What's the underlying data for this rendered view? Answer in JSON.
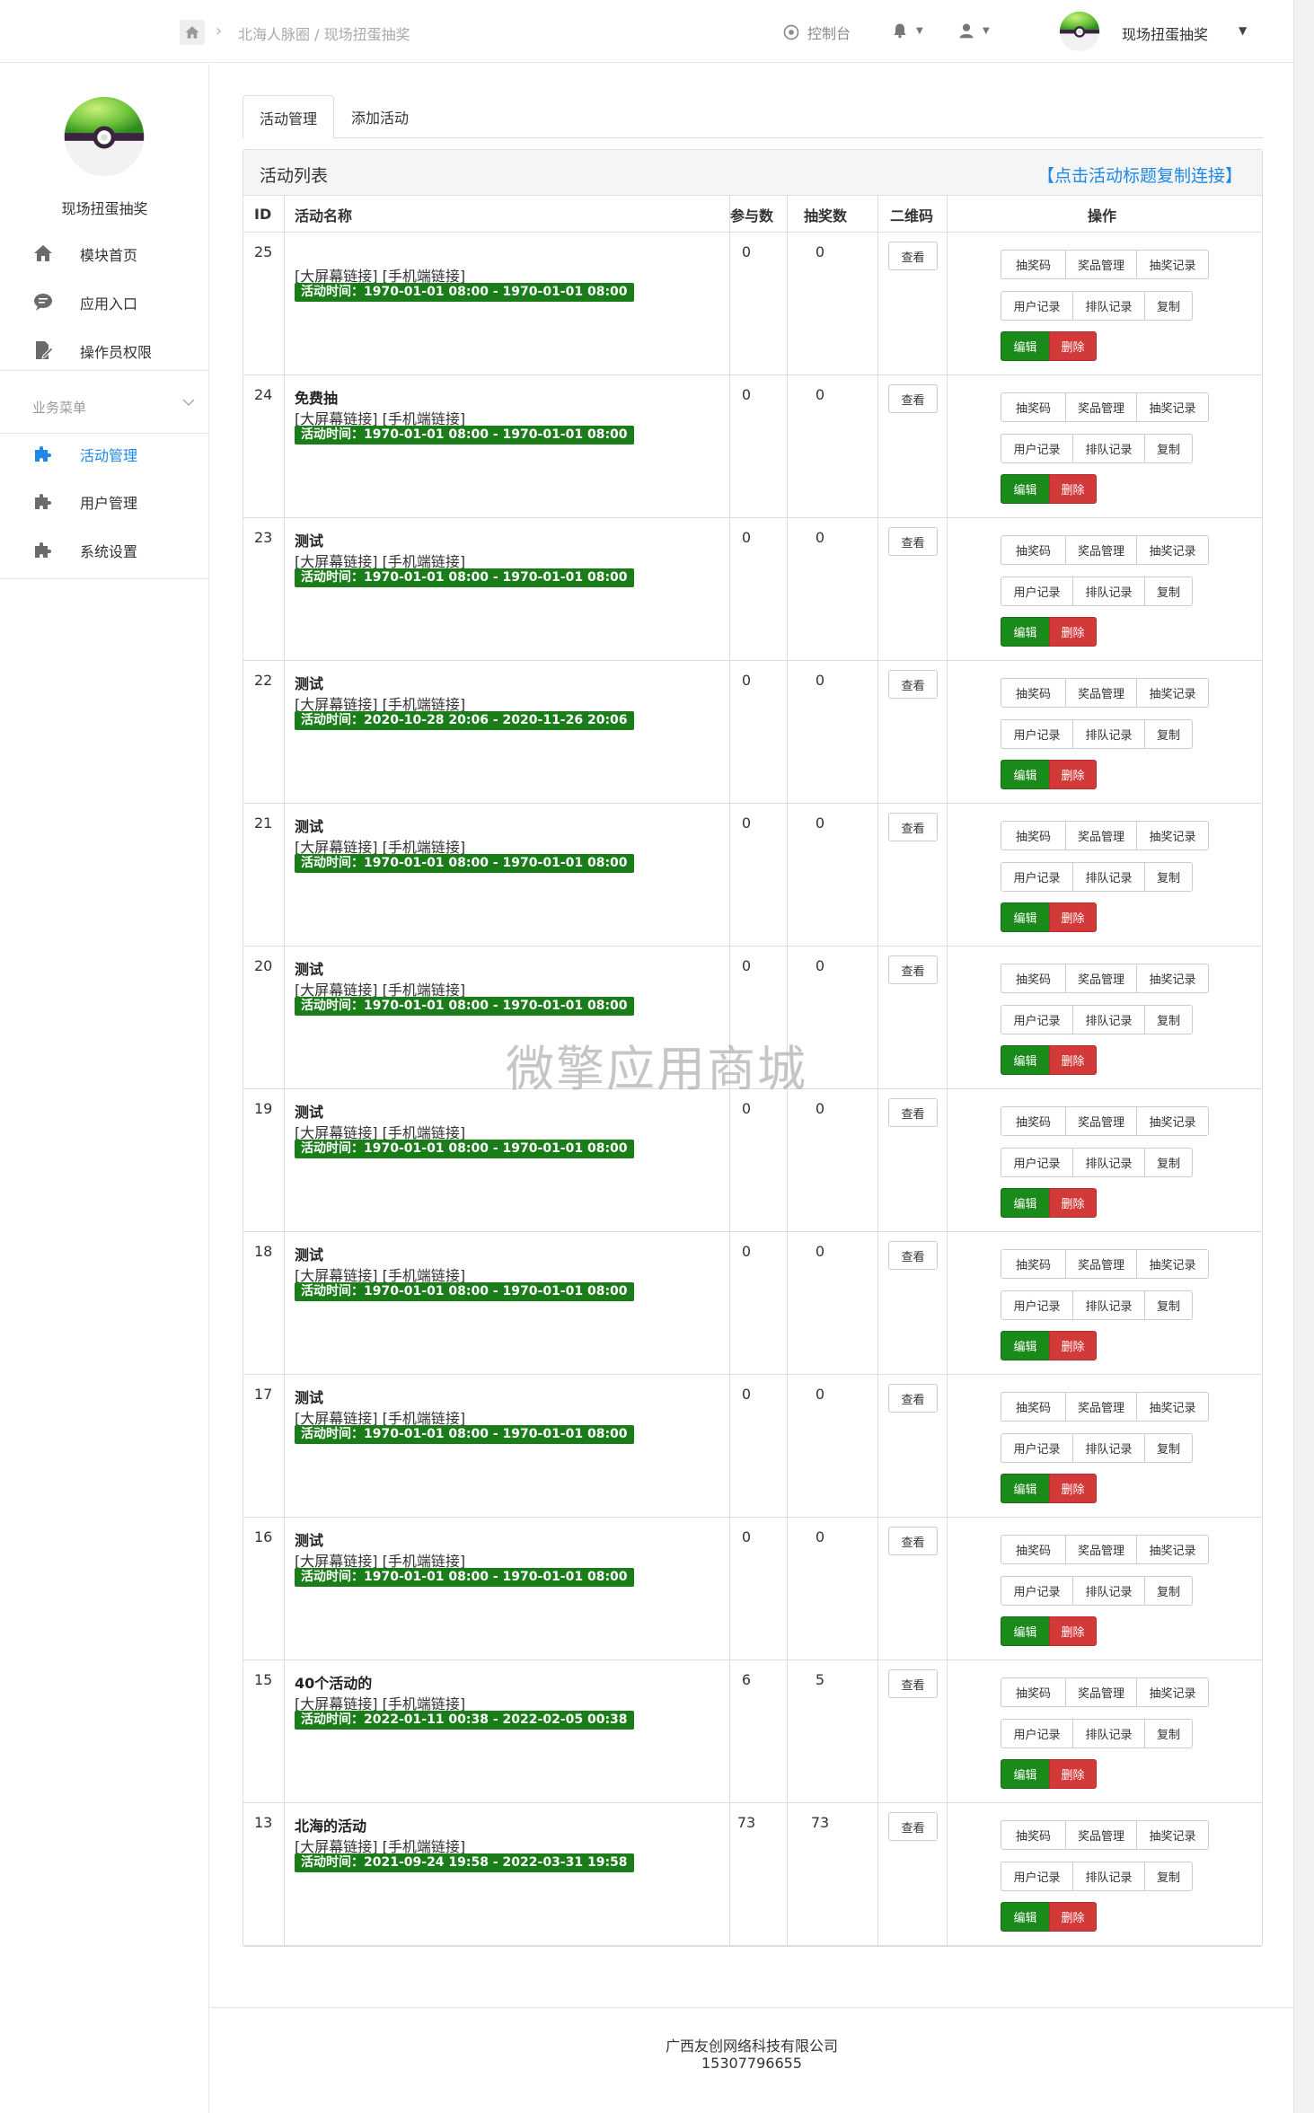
{
  "topbar": {
    "breadcrumb": "北海人脉圈 / 现场扭蛋抽奖",
    "console_label": "控制台",
    "app_name": "现场扭蛋抽奖"
  },
  "sidebar": {
    "app_name": "现场扭蛋抽奖",
    "items": [
      {
        "label": "模块首页",
        "icon": "home-icon"
      },
      {
        "label": "应用入口",
        "icon": "chat-icon"
      },
      {
        "label": "操作员权限",
        "icon": "edit-doc-icon"
      }
    ],
    "section_label": "业务菜单",
    "business_items": [
      {
        "label": "活动管理",
        "icon": "puzzle-icon",
        "active": true
      },
      {
        "label": "用户管理",
        "icon": "puzzle-icon",
        "active": false
      },
      {
        "label": "系统设置",
        "icon": "puzzle-icon",
        "active": false
      }
    ]
  },
  "tabs": [
    "活动管理",
    "添加活动"
  ],
  "panel": {
    "title": "活动列表",
    "copy_hint": "【点击活动标题复制连接】"
  },
  "table": {
    "headers": [
      "ID",
      "活动名称",
      "参与数",
      "抽奖数",
      "二维码",
      "操作"
    ],
    "link_text": "[大屏幕链接] [手机端链接]",
    "qr_button": "查看",
    "action_buttons": [
      "抽奖码",
      "奖品管理",
      "抽奖记录",
      "用户记录",
      "排队记录",
      "复制",
      "编辑",
      "删除"
    ],
    "rows": [
      {
        "id": "25",
        "name": "",
        "time": "活动时间：1970-01-01 08:00 - 1970-01-01 08:00",
        "participants": "0",
        "draws": "0"
      },
      {
        "id": "24",
        "name": "免费抽",
        "time": "活动时间：1970-01-01 08:00 - 1970-01-01 08:00",
        "participants": "0",
        "draws": "0"
      },
      {
        "id": "23",
        "name": "测试",
        "time": "活动时间：1970-01-01 08:00 - 1970-01-01 08:00",
        "participants": "0",
        "draws": "0"
      },
      {
        "id": "22",
        "name": "测试",
        "time": "活动时间：2020-10-28 20:06 - 2020-11-26 20:06",
        "participants": "0",
        "draws": "0"
      },
      {
        "id": "21",
        "name": "测试",
        "time": "活动时间：1970-01-01 08:00 - 1970-01-01 08:00",
        "participants": "0",
        "draws": "0"
      },
      {
        "id": "20",
        "name": "测试",
        "time": "活动时间：1970-01-01 08:00 - 1970-01-01 08:00",
        "participants": "0",
        "draws": "0"
      },
      {
        "id": "19",
        "name": "测试",
        "time": "活动时间：1970-01-01 08:00 - 1970-01-01 08:00",
        "participants": "0",
        "draws": "0"
      },
      {
        "id": "18",
        "name": "测试",
        "time": "活动时间：1970-01-01 08:00 - 1970-01-01 08:00",
        "participants": "0",
        "draws": "0"
      },
      {
        "id": "17",
        "name": "测试",
        "time": "活动时间：1970-01-01 08:00 - 1970-01-01 08:00",
        "participants": "0",
        "draws": "0"
      },
      {
        "id": "16",
        "name": "测试",
        "time": "活动时间：1970-01-01 08:00 - 1970-01-01 08:00",
        "participants": "0",
        "draws": "0"
      },
      {
        "id": "15",
        "name": "40个活动的",
        "time": "活动时间：2022-01-11 00:38 - 2022-02-05 00:38",
        "participants": "6",
        "draws": "5"
      },
      {
        "id": "13",
        "name": "北海的活动",
        "time": "活动时间：2021-09-24 19:58 - 2022-03-31 19:58",
        "participants": "73",
        "draws": "73"
      }
    ]
  },
  "watermark": "微擎应用商城",
  "footer": {
    "company": "广西友创网络科技有限公司",
    "phone": "15307796655"
  },
  "colors": {
    "accent": "#1e88e5",
    "success": "#1a8a1a",
    "danger": "#d23a3a",
    "time_badge": "#1a7d1a"
  }
}
